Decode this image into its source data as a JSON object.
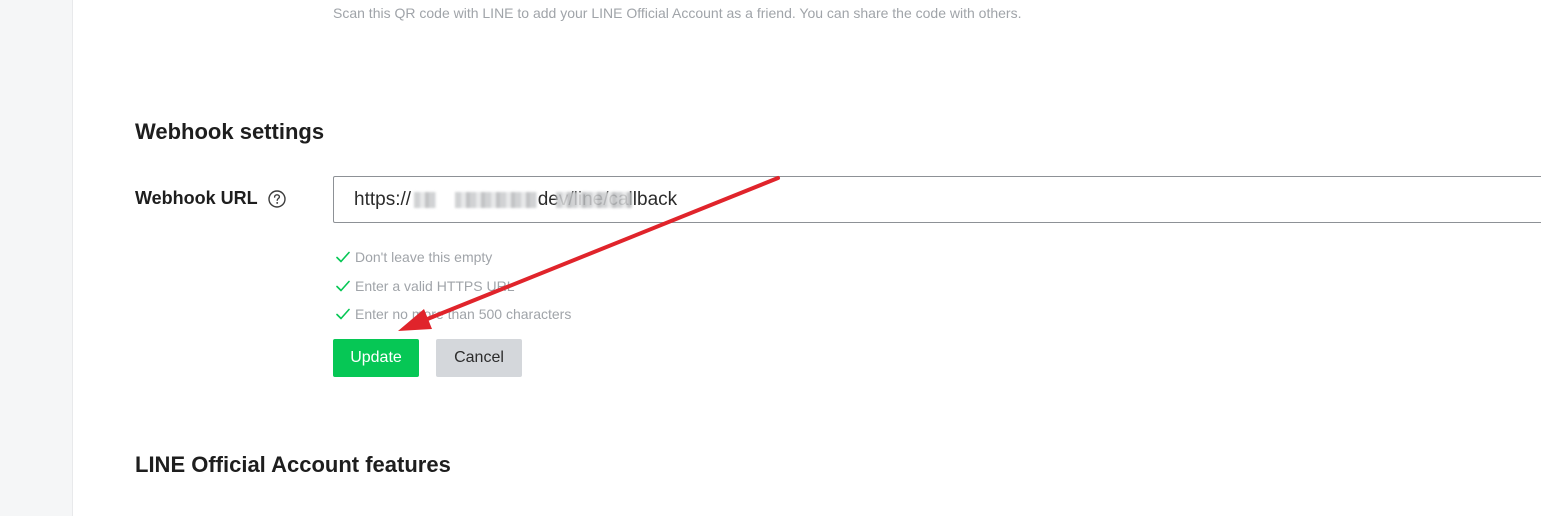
{
  "qr": {
    "description": "Scan this QR code with LINE to add your LINE Official Account as a friend. You can share the code with others."
  },
  "webhook": {
    "title": "Webhook settings",
    "url_label": "Webhook URL",
    "help_icon": "question-circle-icon",
    "url_value": "https://                        dev/line/callback",
    "validations": [
      "Don't leave this empty",
      "Enter a valid HTTPS URL",
      "Enter no more than 500 characters"
    ],
    "update_label": "Update",
    "cancel_label": "Cancel"
  },
  "features": {
    "title": "LINE Official Account features"
  },
  "colors": {
    "accent_green": "#06c755",
    "check_green": "#06c755",
    "annotation_red": "#e0242b"
  }
}
